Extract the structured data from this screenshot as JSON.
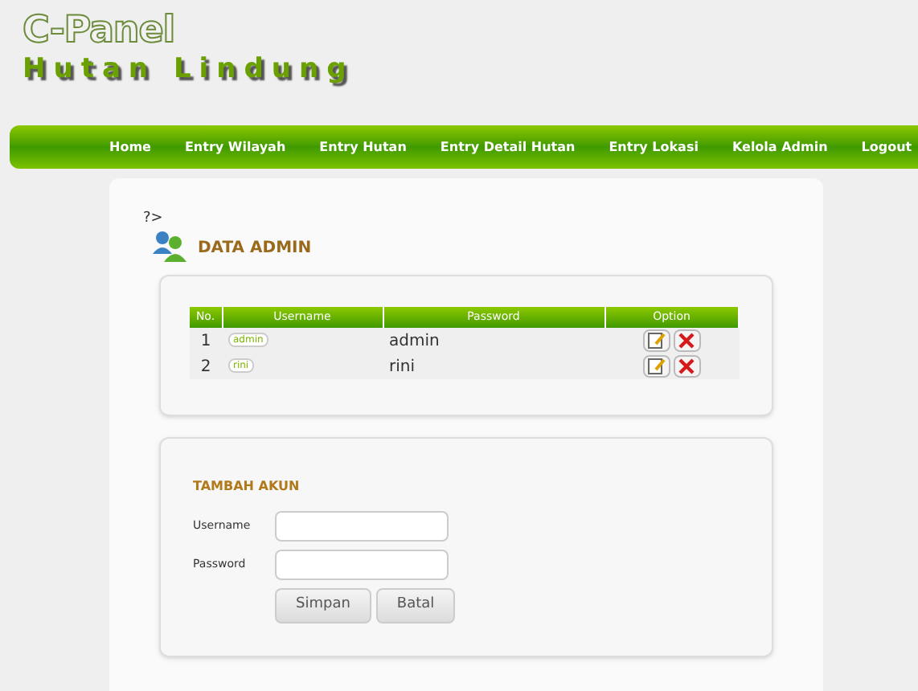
{
  "logo": {
    "title": "C-Panel",
    "subtitle": "Hutan Lindung"
  },
  "nav": [
    {
      "label": "Home"
    },
    {
      "label": "Entry Wilayah"
    },
    {
      "label": "Entry Hutan"
    },
    {
      "label": "Entry Detail Hutan"
    },
    {
      "label": "Entry Lokasi"
    },
    {
      "label": "Kelola Admin"
    },
    {
      "label": "Logout"
    }
  ],
  "stray_text": "?>",
  "section_title": "DATA ADMIN",
  "table": {
    "columns": [
      "No.",
      "Username",
      "Password",
      "Option"
    ],
    "rows": [
      {
        "no": "1",
        "username": "admin",
        "password": "admin"
      },
      {
        "no": "2",
        "username": "rini",
        "password": "rini"
      }
    ]
  },
  "form": {
    "title": "TAMBAH AKUN",
    "fields": [
      {
        "label": "Username"
      },
      {
        "label": "Password"
      }
    ],
    "buttons": [
      "Simpan",
      "Batal"
    ]
  }
}
